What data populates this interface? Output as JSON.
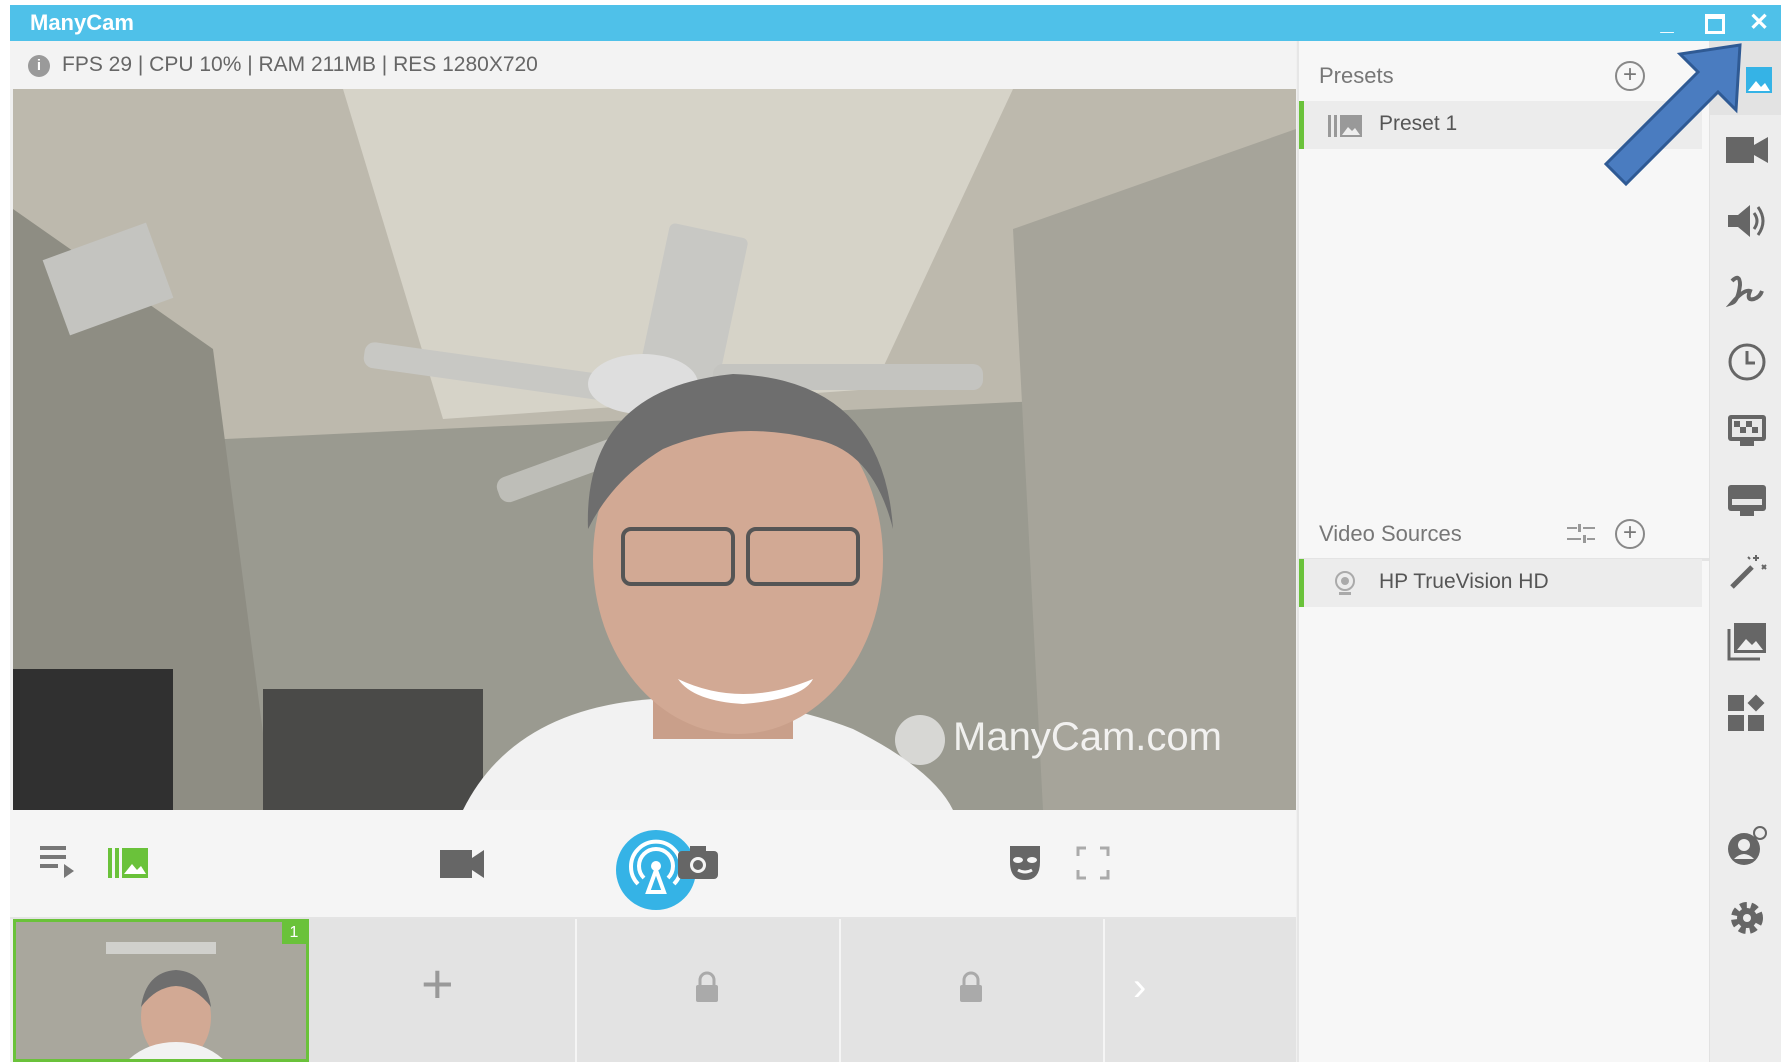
{
  "app": {
    "title": "ManyCam"
  },
  "window_controls": {
    "minimize": "_",
    "close": "✕"
  },
  "status": {
    "text": "FPS 29 | CPU 10% | RAM 211MB | RES 1280X720"
  },
  "video": {
    "watermark": "ManyCam.com"
  },
  "thumbnails": {
    "active_badge": "1",
    "add_symbol": "+",
    "next_symbol": "›"
  },
  "presets": {
    "title": "Presets",
    "items": [
      {
        "label": "Preset 1"
      }
    ]
  },
  "video_sources": {
    "title": "Video Sources",
    "items": [
      {
        "label": "HP TrueVision HD"
      }
    ]
  },
  "colors": {
    "titlebar": "#4fc1e9",
    "accent_green": "#6ac23a",
    "broadcast_blue": "#35b3e6",
    "annotation_arrow": "#4a7cc0"
  }
}
